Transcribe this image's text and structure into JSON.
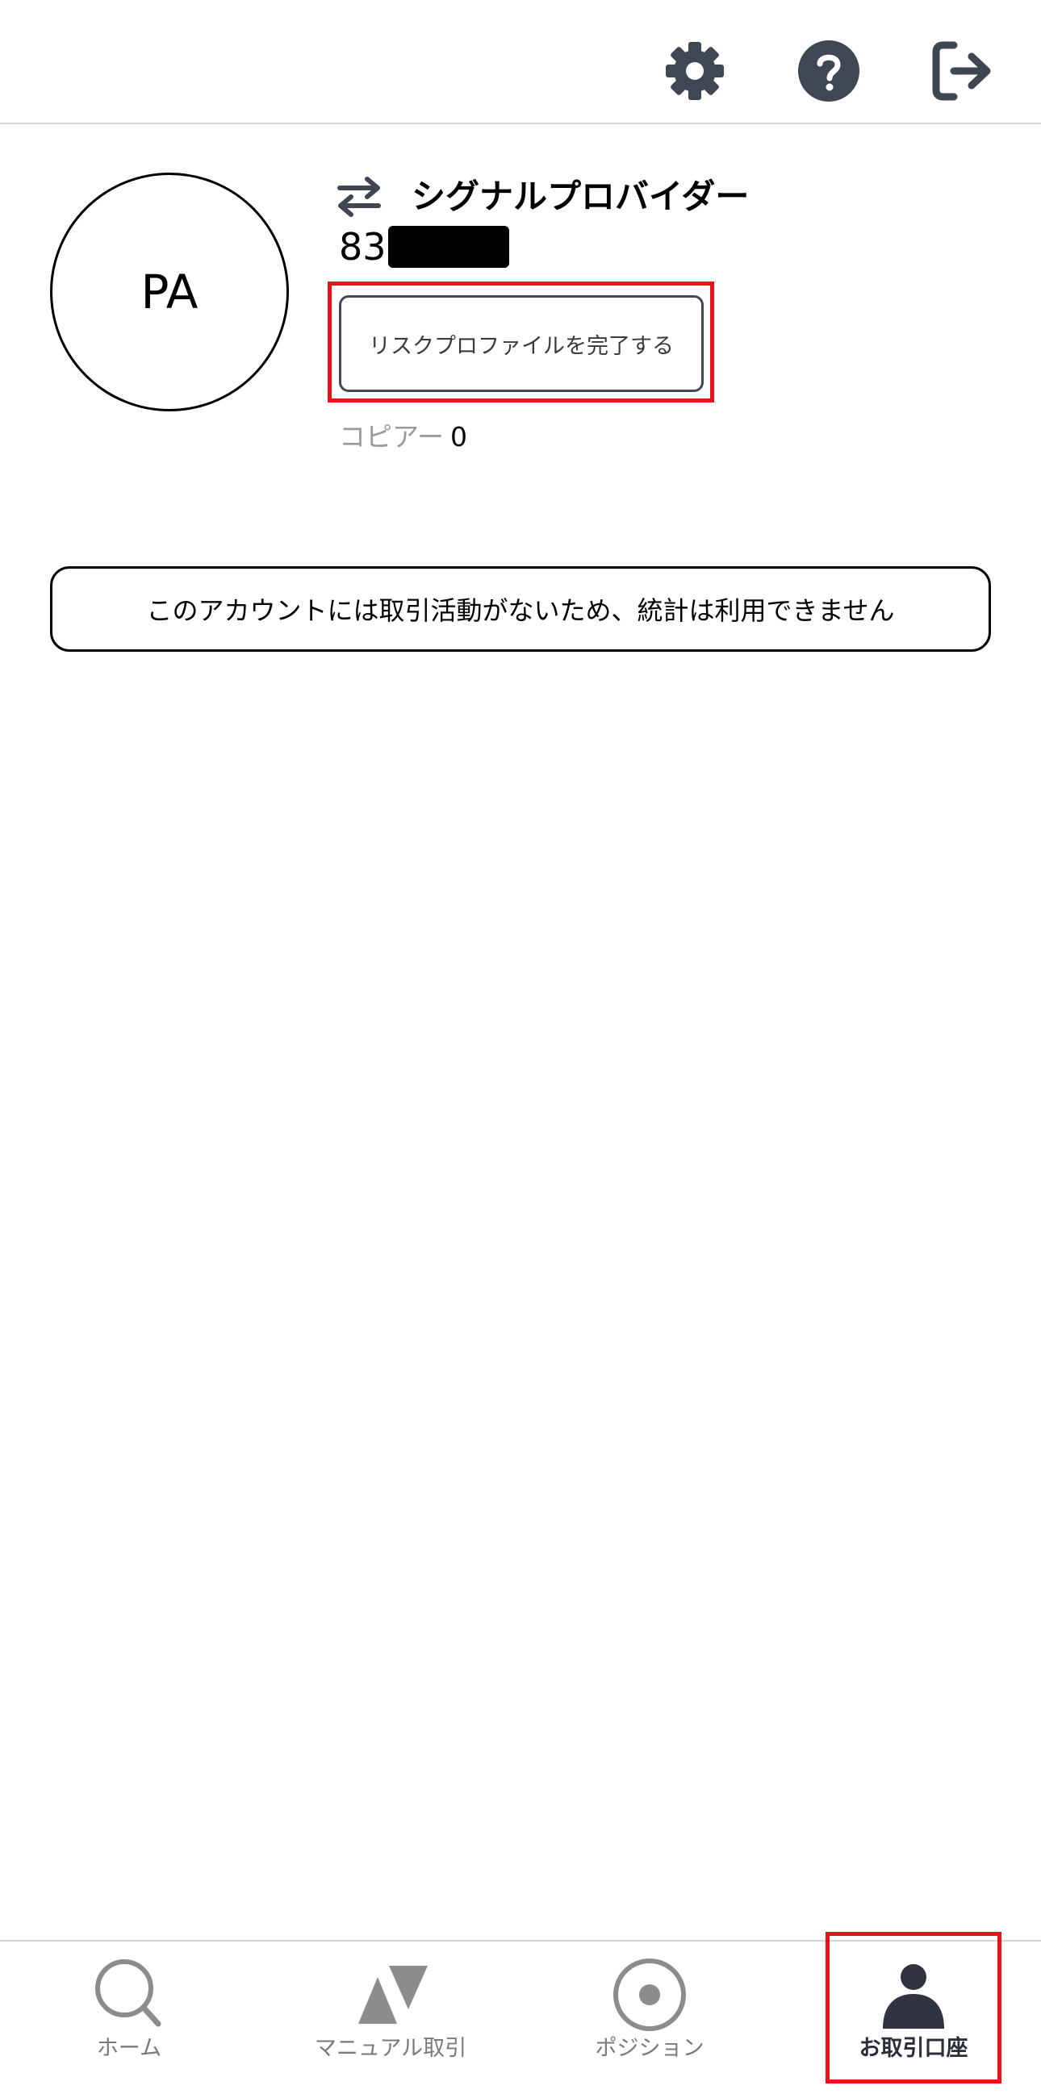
{
  "colors": {
    "icon_dark": "#414653",
    "highlight_red": "#e8141c",
    "inactive_gray": "#8c8c8c",
    "divider": "#d4d4d4"
  },
  "header": {
    "icons": [
      "gear-icon",
      "question-icon",
      "logout-icon"
    ]
  },
  "profile": {
    "avatar_initials": "PA",
    "role_icon": "swap-arrows-icon",
    "role_title": "シグナルプロバイダー",
    "account_number_visible": "83",
    "risk_button_label": "リスクプロファイルを完了する",
    "copiers_label": "コピアー",
    "copiers_count": "0"
  },
  "notice": {
    "text": "このアカウントには取引活動がないため、統計は利用できません"
  },
  "bottom_nav": {
    "items": [
      {
        "label": "ホーム",
        "icon": "search-icon",
        "active": false
      },
      {
        "label": "マニュアル取引",
        "icon": "triangles-icon",
        "active": false
      },
      {
        "label": "ポジション",
        "icon": "target-icon",
        "active": false
      },
      {
        "label": "お取引口座",
        "icon": "person-icon",
        "active": true
      }
    ]
  }
}
